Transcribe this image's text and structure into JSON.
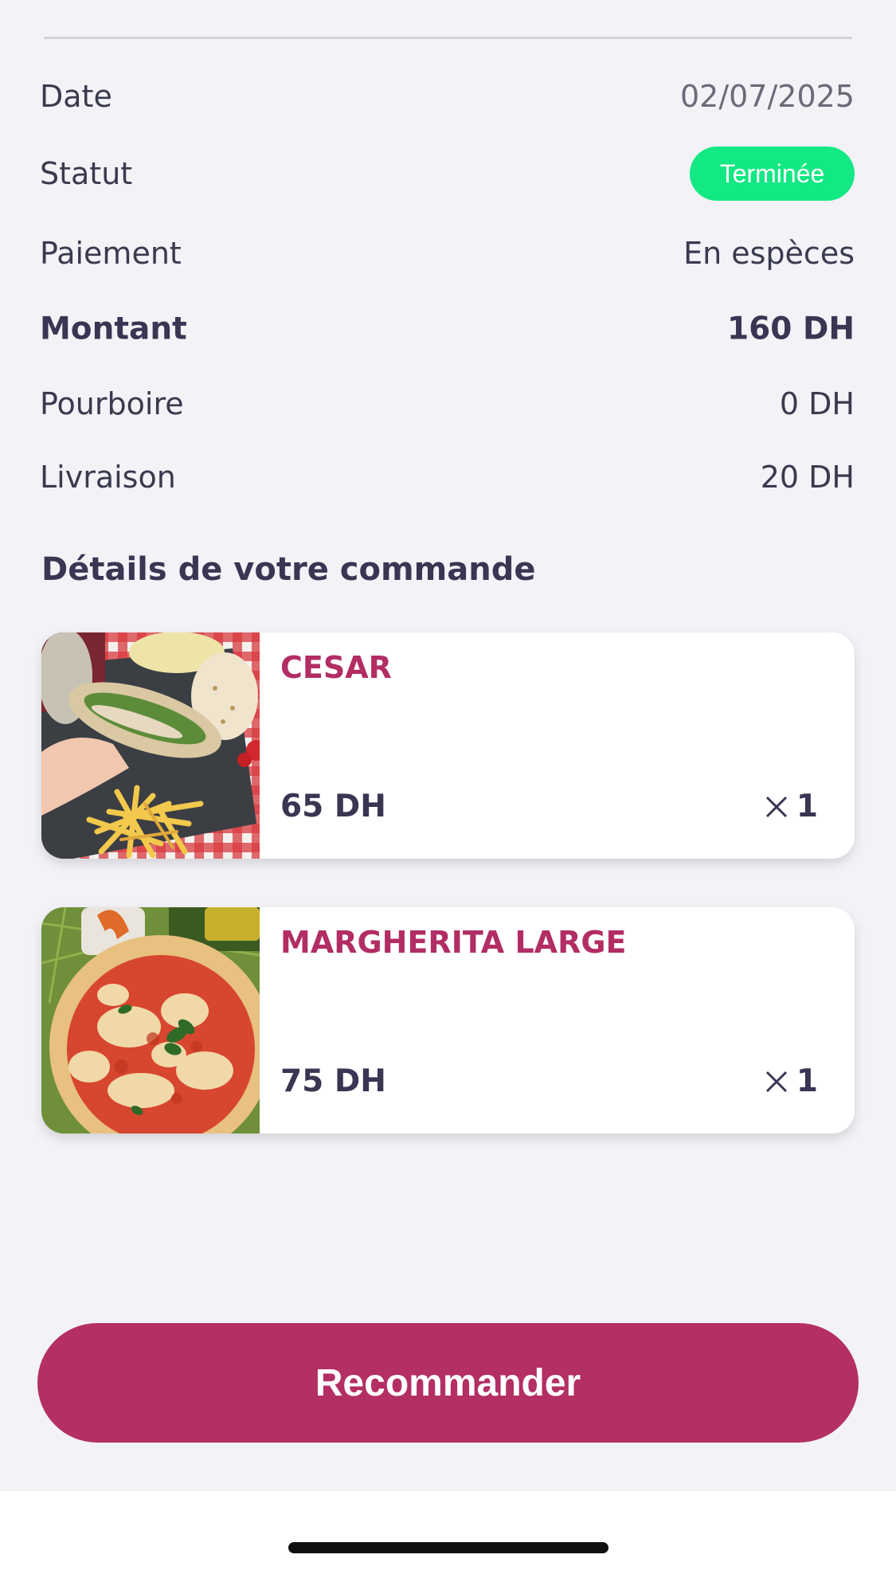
{
  "order_info": [
    {
      "label": "Date",
      "value": "02/07/2025"
    },
    {
      "label": "Statut",
      "value": "Terminée"
    },
    {
      "label": "Paiement",
      "value": "En espèces"
    },
    {
      "label": "Montant",
      "value": "160 DH"
    },
    {
      "label": "Pourboire",
      "value": "0 DH"
    },
    {
      "label": "Livraison",
      "value": "20 DH"
    }
  ],
  "status_color": "#12e883",
  "brand_color": "#b32f64",
  "section_title": "Détails de votre commande",
  "items": [
    {
      "name": "CESAR",
      "price": "65 DH",
      "quantity": "1",
      "photo": "wrap-and-fries-photo"
    },
    {
      "name": "MARGHERITA LARGE",
      "price": "75 DH",
      "quantity": "1",
      "photo": "margherita-pizza-photo"
    }
  ],
  "quantity_icon": "times-icon",
  "reorder_label": "Recommander"
}
